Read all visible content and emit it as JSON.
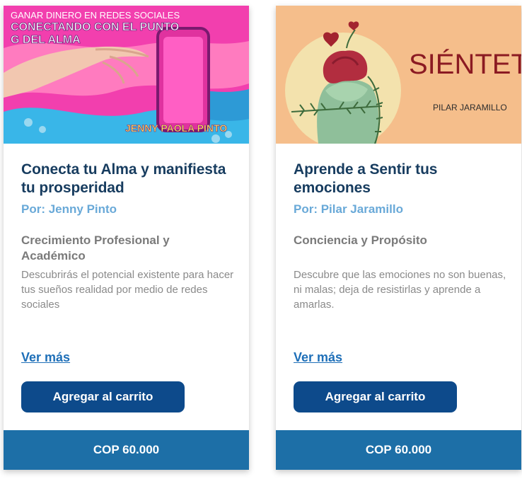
{
  "cards": [
    {
      "image": {
        "line1": "GANAR DINERO EN REDES SOCIALES",
        "line2": "CONECTANDO CON EL PUNTO",
        "line3": "G DEL ALMA",
        "author": "JENNY PAOLA PINTO"
      },
      "title": "Conecta tu Alma y manifiesta tu prosperidad",
      "author": "Por: Jenny Pinto",
      "category": "Crecimiento Profesional y Académico",
      "description": "Descubrirás el potencial existente para hacer tus sueños realidad por medio de redes sociales",
      "more_link": "Ver más",
      "cart_button": "Agregar al carrito",
      "price": "COP 60.000"
    },
    {
      "image": {
        "title": "SIÉNTETE",
        "author": "PILAR JARAMILLO"
      },
      "title": "Aprende a Sentir tus emociones",
      "author": "Por: Pilar Jaramillo",
      "category": "Conciencia y Propósito",
      "description": "Descubre que las emociones no son buenas, ni malas; deja de resistirlas y aprende a amarlas.",
      "more_link": "Ver más",
      "cart_button": "Agregar al carrito",
      "price": "COP 60.000"
    }
  ],
  "colors": {
    "title": "#173c5f",
    "author": "#69a9d8",
    "button": "#0d4a8b",
    "price_bar": "#1d6fa7",
    "link": "#1e6fb8"
  }
}
